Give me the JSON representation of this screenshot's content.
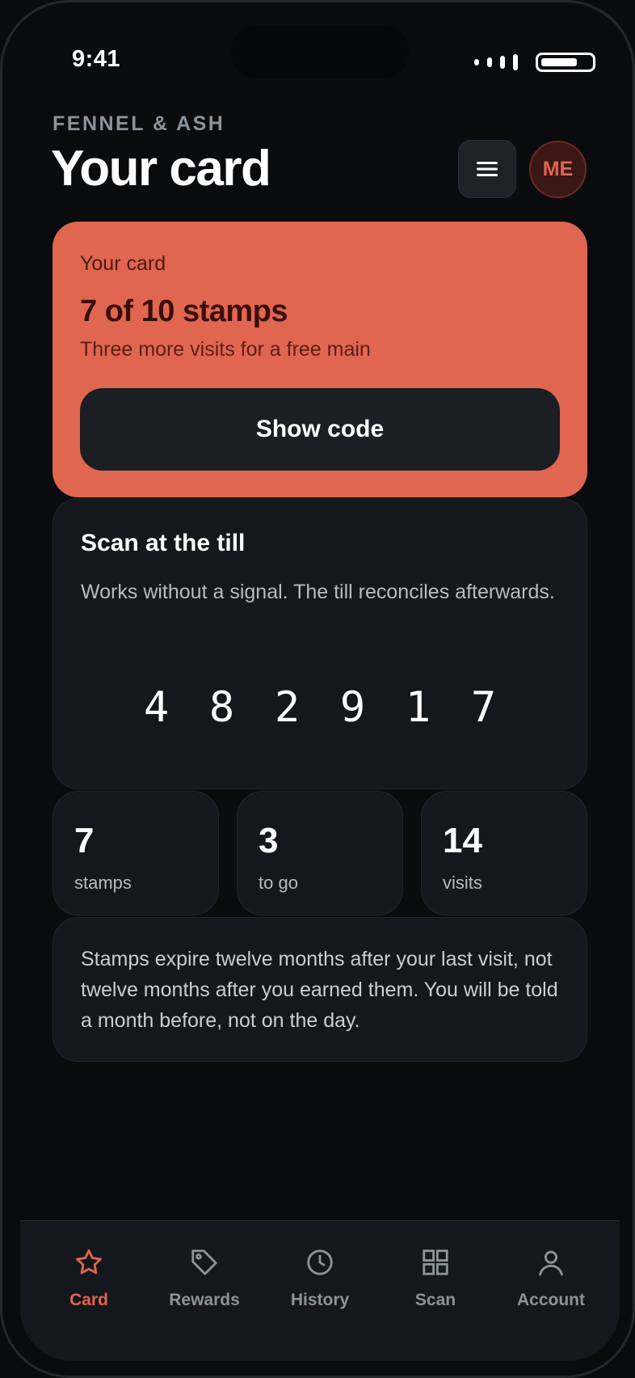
{
  "status_bar": {
    "time": "9:41"
  },
  "header": {
    "brand": "FENNEL & ASH",
    "title": "Your card",
    "menu_icon": "hamburger-menu-icon",
    "avatar_initials": "ME"
  },
  "hero": {
    "eyebrow": "Your card",
    "title": "7 of 10 stamps",
    "subtitle": "Three more visits for a free main",
    "button_label": "Show code"
  },
  "scan": {
    "title": "Scan at the till",
    "description": "Works without a signal. The till reconciles afterwards.",
    "code_digits": [
      "4",
      "8",
      "2",
      "9",
      "1",
      "7"
    ]
  },
  "stats": [
    {
      "value": "7",
      "label": "stamps"
    },
    {
      "value": "3",
      "label": "to go"
    },
    {
      "value": "14",
      "label": "visits"
    }
  ],
  "note": "Stamps expire twelve months after your last visit, not twelve months after you earned them. You will be told a month before, not on the day.",
  "tabs": [
    {
      "label": "Card",
      "icon": "star-icon",
      "active": true
    },
    {
      "label": "Rewards",
      "icon": "tag-icon",
      "active": false
    },
    {
      "label": "History",
      "icon": "clock-icon",
      "active": false
    },
    {
      "label": "Scan",
      "icon": "grid-icon",
      "active": false
    },
    {
      "label": "Account",
      "icon": "user-icon",
      "active": false
    }
  ],
  "colors": {
    "background": "#0a0b0d",
    "accent": "#e06650",
    "card": "#14171b",
    "muted_text": "#8b949c"
  }
}
